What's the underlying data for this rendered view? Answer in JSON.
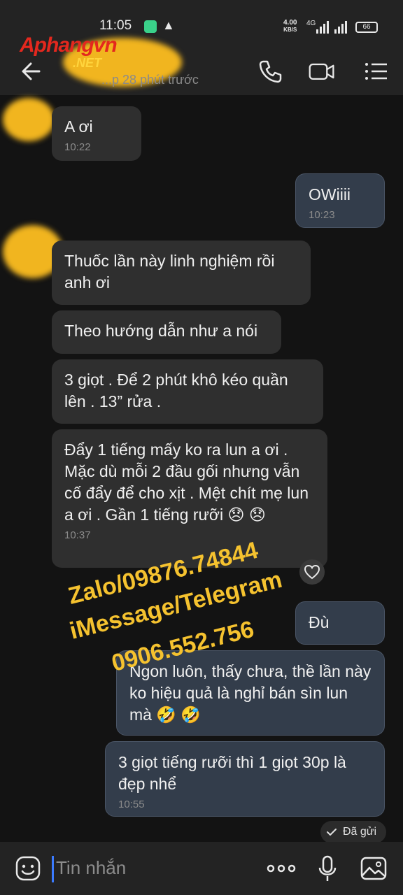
{
  "status_bar": {
    "time": "11:05",
    "speed_value": "4.00",
    "speed_unit": "KB/S",
    "network": "4G",
    "battery": "66"
  },
  "header": {
    "logo_main": "Aphangvn",
    "logo_tld": ".NET",
    "subtitle": "...p 28 phút trước"
  },
  "messages": [
    {
      "side": "in",
      "text": "A ơi",
      "time": "10:22"
    },
    {
      "side": "out",
      "text": "OWiiii",
      "time": "10:23"
    },
    {
      "side": "in",
      "text": "Thuốc lần này linh nghiệm rồi anh ơi",
      "time": ""
    },
    {
      "side": "in",
      "text": "Theo hướng dẫn như a nói",
      "time": ""
    },
    {
      "side": "in",
      "text": "3 giọt . Để 2 phút khô kéo quần lên . 13” rửa .",
      "time": ""
    },
    {
      "side": "in",
      "text": "Đẩy 1 tiếng mấy ko ra lun a ơi . Mặc dù mỗi 2 đầu gối nhưng vẫn cố đẩy để cho xịt . Mệt chít mẹ lun a ơi . Gần 1 tiếng rưỡi 😞 😞",
      "time": "10:37"
    },
    {
      "side": "out",
      "text": "Đù",
      "time": ""
    },
    {
      "side": "out",
      "text": "Ngon luôn, thấy chưa, thề lần này ko hiệu quả là nghỉ bán sìn lun mà 🤣 🤣",
      "time": ""
    },
    {
      "side": "out",
      "text": "3 giọt tiếng rưỡi thì 1 giọt 30p là đẹp nhể",
      "time": "10:55"
    }
  ],
  "watermark": {
    "line1": "Zalo/09876.74844",
    "line2": "iMessage/Telegram",
    "line3": "0906.552.756"
  },
  "sent_status": "Đã gửi",
  "input": {
    "placeholder": "Tin nhắn"
  },
  "colors": {
    "background": "#131313",
    "incoming_bubble": "#2f2f2f",
    "outgoing_bubble": "#333d4b",
    "watermark": "#f5c22f",
    "logo_red": "#e4281e"
  }
}
